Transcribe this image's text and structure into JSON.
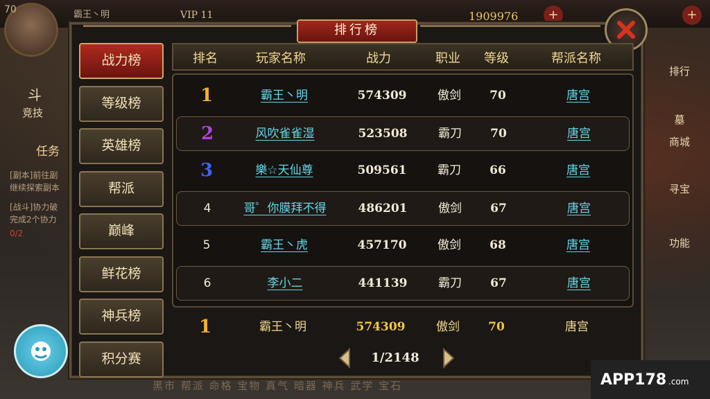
{
  "hud": {
    "level": "70",
    "player_name": "霸王丶明",
    "vip": "VIP 11",
    "gold": "1909976",
    "plus": "+",
    "left_items": [
      "斗",
      "竞技",
      "任务",
      "[副本]前往副",
      "继续探索副本",
      "[战斗]协力破",
      "完成2个协力",
      "0/2"
    ],
    "right_items": [
      "排行",
      "墓",
      "商城",
      "寻宝",
      "功能"
    ],
    "bottom_nav": "黑市  帮派  命格  宝物  真气  暗器  神兵  武学  宝石"
  },
  "panel": {
    "title": "排行榜",
    "close_icon": "close-x-icon"
  },
  "tabs": [
    {
      "label": "战力榜",
      "active": true
    },
    {
      "label": "等级榜"
    },
    {
      "label": "英雄榜"
    },
    {
      "label": "帮派"
    },
    {
      "label": "巅峰"
    },
    {
      "label": "鲜花榜"
    },
    {
      "label": "神兵榜"
    },
    {
      "label": "积分赛"
    }
  ],
  "columns": [
    "排名",
    "玩家名称",
    "战力",
    "职业",
    "等级",
    "帮派名称"
  ],
  "rows": [
    {
      "rank": "1",
      "name": "霸王丶明",
      "power": "574309",
      "class": "傲剑",
      "level": "70",
      "guild": "唐宫"
    },
    {
      "rank": "2",
      "name": "风吹雀雀湿",
      "power": "523508",
      "class": "霸刀",
      "level": "70",
      "guild": "唐宫"
    },
    {
      "rank": "3",
      "name": "樂☆天仙尊",
      "power": "509561",
      "class": "霸刀",
      "level": "66",
      "guild": "唐宫"
    },
    {
      "rank": "4",
      "name": "哥゜你膜拜不得",
      "power": "486201",
      "class": "傲剑",
      "level": "67",
      "guild": "唐宫"
    },
    {
      "rank": "5",
      "name": "霸王丶虎",
      "power": "457170",
      "class": "傲剑",
      "level": "68",
      "guild": "唐宫"
    },
    {
      "rank": "6",
      "name": "李小二",
      "power": "441139",
      "class": "霸刀",
      "level": "67",
      "guild": "唐宫"
    }
  ],
  "self_row": {
    "rank": "1",
    "name": "霸王丶明",
    "power": "574309",
    "class": "傲剑",
    "level": "70",
    "guild": "唐宫"
  },
  "pager": {
    "text": "1/2148"
  },
  "watermark": {
    "text": "APP178",
    "sub": ".com"
  },
  "colors": {
    "gold": "#f4b030",
    "purple": "#b040e0",
    "blue": "#4060f0",
    "link": "#64d6e8",
    "accent_red": "#b02a1e"
  }
}
